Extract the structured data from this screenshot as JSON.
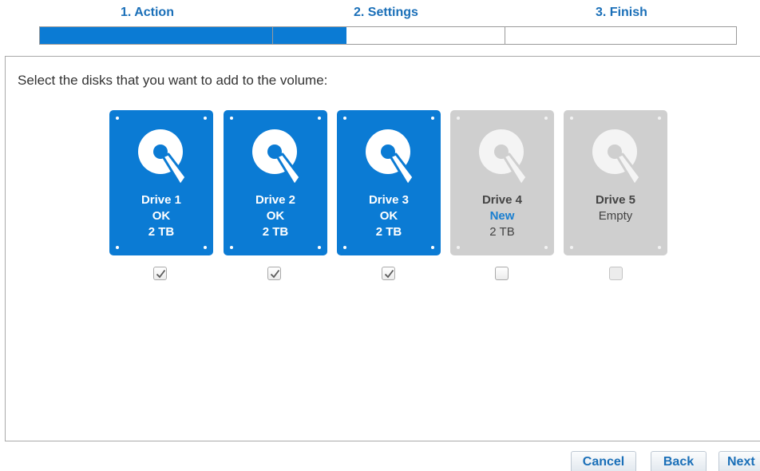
{
  "wizard": {
    "steps": [
      {
        "label": "1. Action"
      },
      {
        "label": "2. Settings"
      },
      {
        "label": "3. Finish"
      }
    ],
    "progress_fraction": 0.44
  },
  "main": {
    "instruction": "Select the disks that you want to add to the volume:",
    "drives": [
      {
        "name": "Drive 1",
        "status": "OK",
        "size": "2 TB",
        "selected": true,
        "checked": true
      },
      {
        "name": "Drive 2",
        "status": "OK",
        "size": "2 TB",
        "selected": true,
        "checked": true
      },
      {
        "name": "Drive 3",
        "status": "OK",
        "size": "2 TB",
        "selected": true,
        "checked": true
      },
      {
        "name": "Drive 4",
        "status": "New",
        "size": "2 TB",
        "selected": false,
        "checked": false
      },
      {
        "name": "Drive 5",
        "status": "Empty",
        "size": "",
        "selected": false,
        "checked": false
      }
    ]
  },
  "buttons": {
    "cancel": "Cancel",
    "back": "Back",
    "next": "Next"
  },
  "colors": {
    "accent": "#0b7bd4",
    "link_text": "#1a6fb8",
    "disabled_drive": "#cfcfcf",
    "new_status": "#1a7fd0"
  },
  "icons": {
    "drive": "hard-disk-icon",
    "check": "checkmark-icon"
  }
}
